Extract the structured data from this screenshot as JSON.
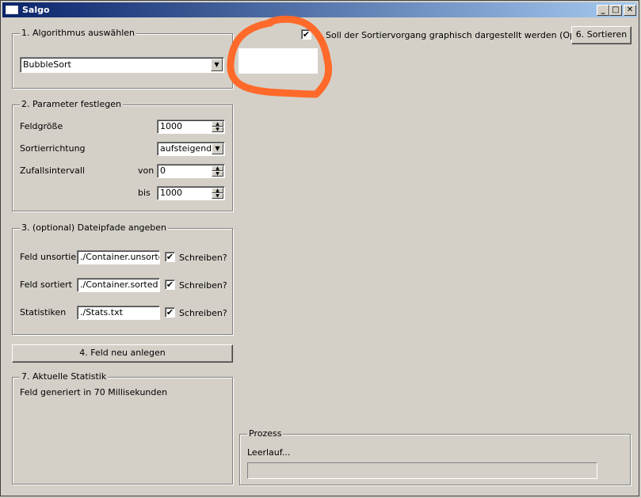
{
  "window": {
    "title": "Salgo",
    "minimize": "_",
    "maximize": "□",
    "close": "✕"
  },
  "algorithm": {
    "group_label": "1. Algorithmus auswählen",
    "selected": "BubbleSort"
  },
  "options": {
    "opengl_label": "Soll der Sortiervorgang graphisch dargestellt werden (OpenGL)?",
    "opengl_checked": "✔",
    "sort_button": "6. Sortieren"
  },
  "params": {
    "group_label": "2. Parameter festlegen",
    "size_label": "Feldgröße",
    "size_value": "1000",
    "direction_label": "Sortierrichtung",
    "direction_value": "aufsteigend",
    "interval_label": "Zufallsintervall",
    "from_label": "von",
    "from_value": "0",
    "to_label": "bis",
    "to_value": "1000"
  },
  "paths": {
    "group_label": "3. (optional) Dateipfade angeben",
    "unsorted_label": "Feld unsortiert",
    "unsorted_value": "./Container.unsorted",
    "sorted_label": "Feld sortiert",
    "sorted_value": "./Container.sorted",
    "stats_label": "Statistiken",
    "stats_value": "./Stats.txt",
    "write_label": "Schreiben?",
    "checked": "✔"
  },
  "new_field_button": "4. Feld neu anlegen",
  "stats": {
    "group_label": "7. Aktuelle Statistik",
    "text": "Feld generiert in 70 Millisekunden"
  },
  "process": {
    "group_label": "Prozess",
    "status": "Leerlauf...",
    "progress": 0
  },
  "colors": {
    "annotation": "#ff6a2a"
  }
}
